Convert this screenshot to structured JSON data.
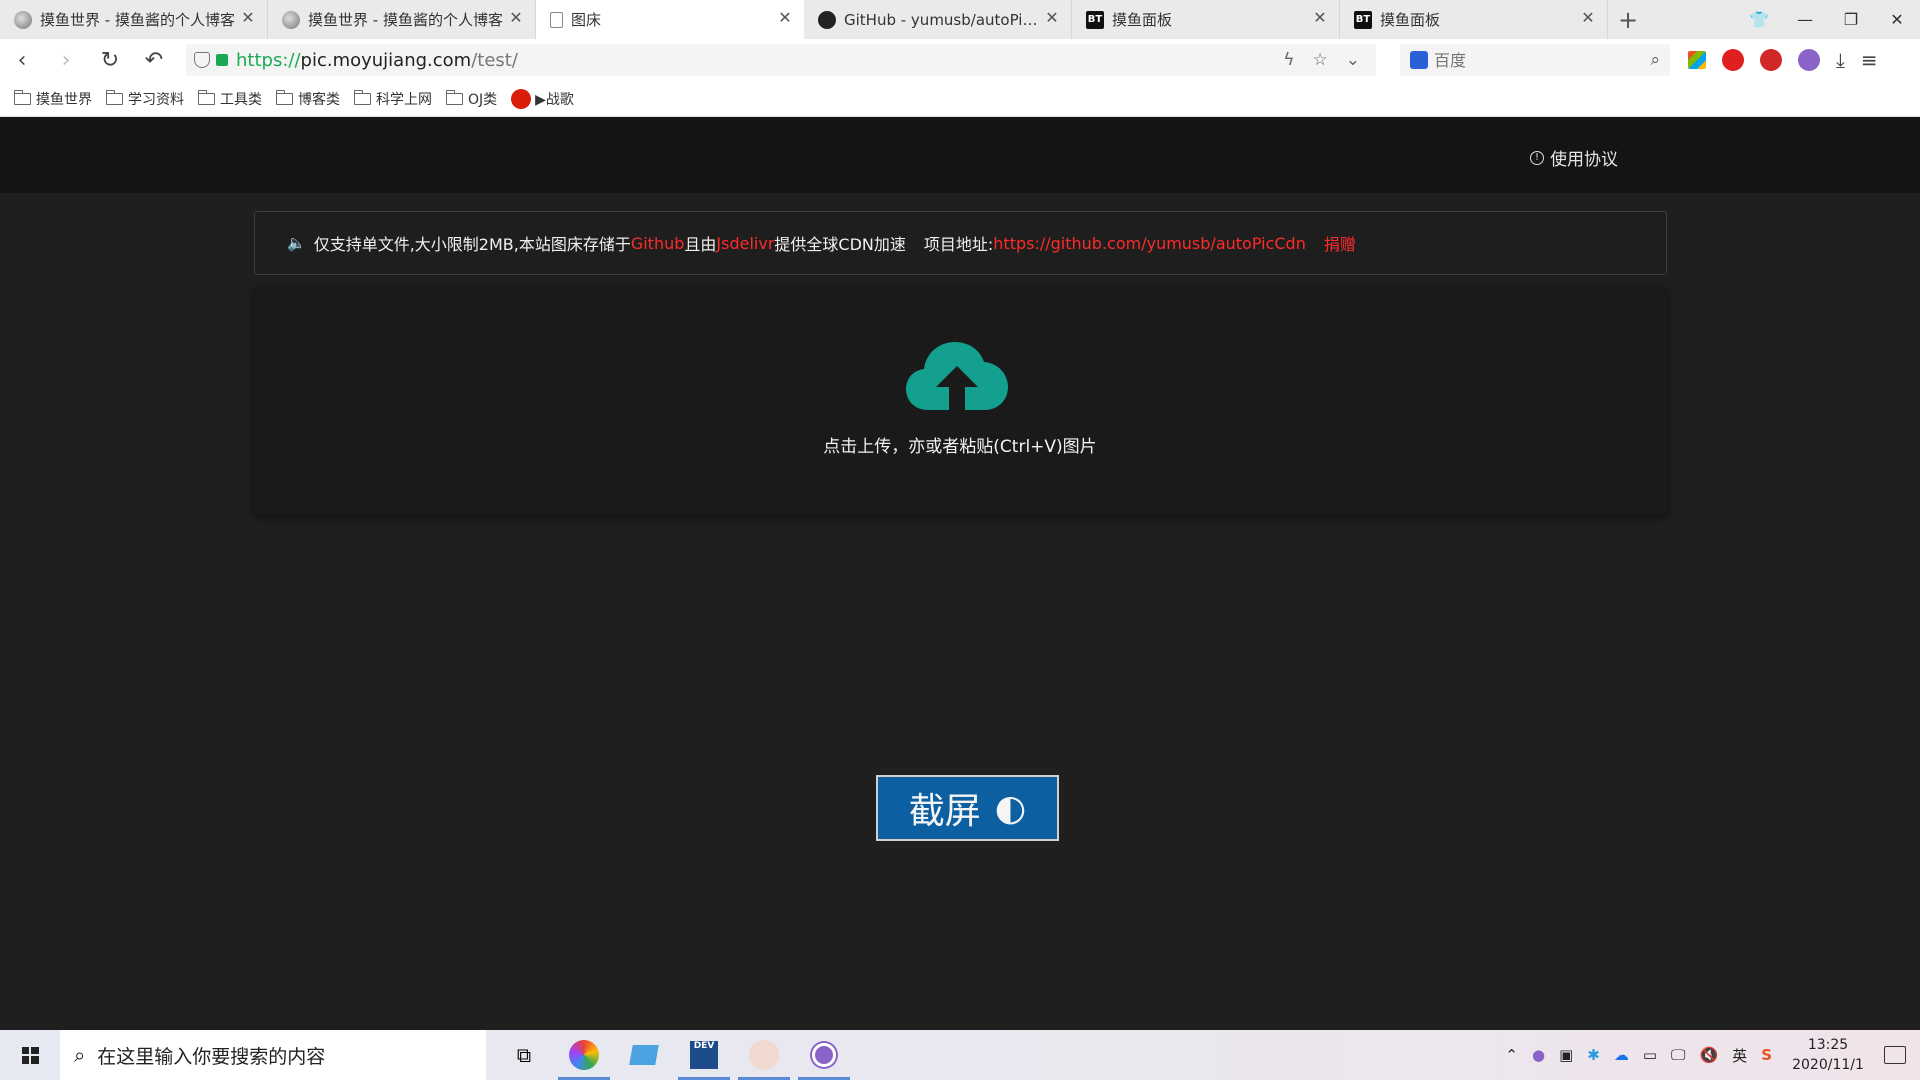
{
  "browser": {
    "tabs": [
      {
        "title": "摸鱼世界 - 摸鱼酱的个人博客",
        "icon": "fish-avatar-icon",
        "active": false
      },
      {
        "title": "摸鱼世界 - 摸鱼酱的个人博客",
        "icon": "fish-avatar-icon",
        "active": false
      },
      {
        "title": "图床",
        "icon": "document-icon",
        "active": true
      },
      {
        "title": "GitHub - yumusb/autoPicCdn",
        "icon": "github-icon",
        "active": false
      },
      {
        "title": "摸鱼面板",
        "icon": "bt-panel-icon",
        "active": false
      },
      {
        "title": "摸鱼面板",
        "icon": "bt-panel-icon",
        "active": false
      }
    ],
    "url": {
      "scheme": "https://",
      "host": "pic.moyujiang.com",
      "path": "/test/"
    },
    "search_placeholder": "百度",
    "bookmarks": [
      "摸鱼世界",
      "学习资料",
      "工具类",
      "博客类",
      "科学上网",
      "OJ类"
    ],
    "music_bookmark": "▶战歌"
  },
  "page": {
    "header": {
      "terms_label": "使用协议"
    },
    "notice": {
      "text1": "仅支持单文件,大小限制2MB,本站图床存储于",
      "github": "Github",
      "text2": "且由",
      "jsdelivr": "Jsdelivr",
      "text3": "提供全球CDN加速",
      "project_label": "项目地址:",
      "project_url": "https://github.com/yumusb/autoPicCdn",
      "donate": "捐赠"
    },
    "upload": {
      "hint": "点击上传，亦或者粘贴(Ctrl+V)图片"
    },
    "screenshot_button": {
      "label": "截屏",
      "icon": "◐"
    }
  },
  "taskbar": {
    "search_placeholder": "在这里输入你要搜索的内容",
    "time": "13:25",
    "date": "2020/11/1",
    "ime": "英"
  },
  "colors": {
    "accent_teal": "#13a08f",
    "link_red": "#ff2a2a",
    "button_blue": "#0c5fa1",
    "page_bg": "#1f1f1f",
    "header_bg": "#141414"
  }
}
